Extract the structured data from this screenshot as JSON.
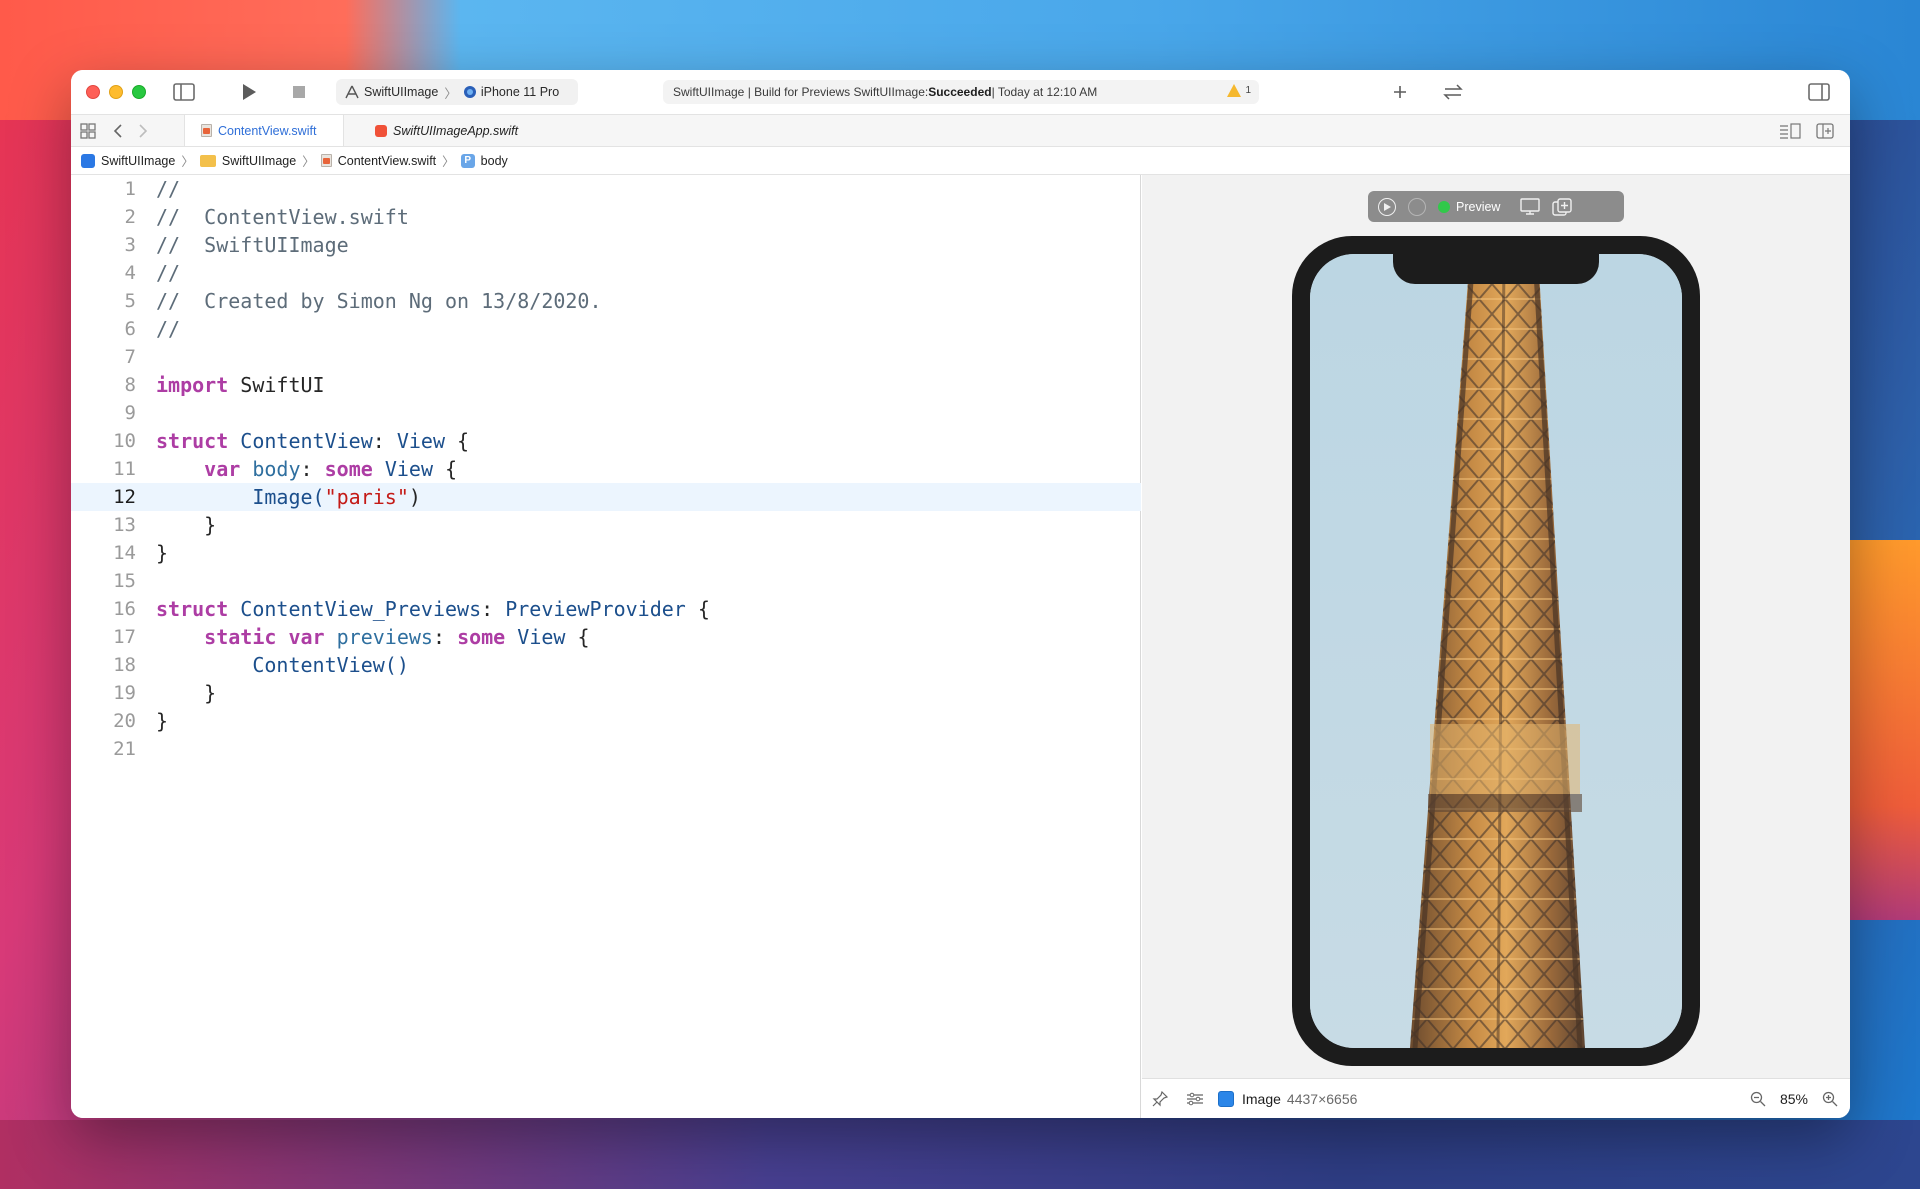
{
  "window": {
    "scheme_target": "SwiftUIImage",
    "scheme_device": "iPhone 11 Pro",
    "activity_prefix": "SwiftUIImage | Build for Previews SwiftUIImage: ",
    "activity_status": "Succeeded",
    "activity_suffix": " | Today at 12:10 AM",
    "warning_count": "1"
  },
  "tabs": [
    {
      "label": "ContentView.swift",
      "active": true
    },
    {
      "label": "SwiftUIImageApp.swift",
      "active": false
    }
  ],
  "breadcrumb": {
    "project": "SwiftUIImage",
    "folder": "SwiftUIImage",
    "file": "ContentView.swift",
    "symbol": "body"
  },
  "editor": {
    "current_line": 12,
    "line_numbers": [
      "1",
      "2",
      "3",
      "4",
      "5",
      "6",
      "7",
      "8",
      "9",
      "10",
      "11",
      "12",
      "13",
      "14",
      "15",
      "16",
      "17",
      "18",
      "19",
      "20",
      "21"
    ],
    "lines": {
      "l1": "//",
      "l2": "//  ContentView.swift",
      "l3": "//  SwiftUIImage",
      "l4": "//",
      "l5": "//  Created by Simon Ng on 13/8/2020.",
      "l6": "//",
      "l8_kw": "import",
      "l8_rest": " SwiftUI",
      "l10_kw": "struct",
      "l10_name": " ContentView",
      "l10_colon": ": ",
      "l10_type": "View",
      "l10_brace": " {",
      "l11_indent": "    ",
      "l11_kw": "var",
      "l11_id": " body",
      "l11_colon": ": ",
      "l11_kw2": "some",
      "l11_type": " View",
      "l11_brace": " {",
      "l12_indent": "        ",
      "l12_call": "Image(",
      "l12_str": "\"paris\"",
      "l12_close": ")",
      "l13": "    }",
      "l14": "}",
      "l16_kw": "struct",
      "l16_name": " ContentView_Previews",
      "l16_colon": ": ",
      "l16_type": "PreviewProvider",
      "l16_brace": " {",
      "l17_indent": "    ",
      "l17_kw": "static",
      "l17_kw2": " var",
      "l17_id": " previews",
      "l17_colon": ": ",
      "l17_kw3": "some",
      "l17_type": " View",
      "l17_brace": " {",
      "l18_indent": "        ",
      "l18_call": "ContentView()",
      "l19": "    }",
      "l20": "}"
    }
  },
  "preview": {
    "label": "Preview",
    "element_name": "Image",
    "element_size": "4437×6656",
    "zoom": "85%"
  },
  "colors": {
    "keyword": "#ad3da4",
    "type": "#1c4f8c",
    "string": "#c41a16",
    "comment": "#5d6c79",
    "accent": "#2f6fd8"
  }
}
